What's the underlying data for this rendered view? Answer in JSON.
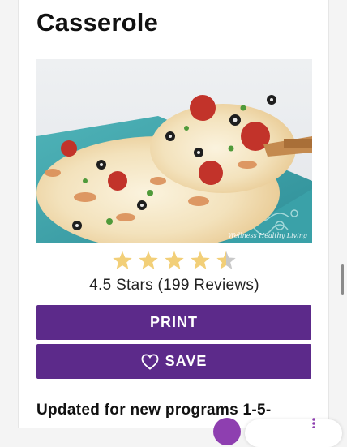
{
  "recipe": {
    "title": "Casserole",
    "image_watermark": "Wellness Healthy Living",
    "rating": {
      "value": 4.5,
      "max": 5,
      "text": "4.5 Stars (199 Reviews)"
    }
  },
  "actions": {
    "print_label": "PRINT",
    "save_label": "SAVE"
  },
  "notes": {
    "updated_text": "Updated for new programs 1-5-"
  },
  "colors": {
    "button": "#5c2a8a",
    "star_fill": "#f2cf78",
    "star_empty": "#c9c9c9",
    "fab": "#8e3fb0"
  },
  "icons": {
    "save": "heart-outline-icon",
    "rating": "star-icon"
  }
}
